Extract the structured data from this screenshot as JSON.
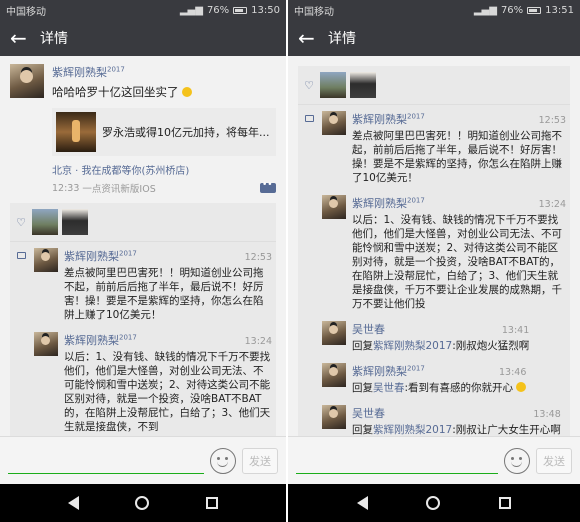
{
  "left": {
    "status": {
      "carrier": "中国移动",
      "battery": "76%",
      "time": "13:50"
    },
    "title": "详情",
    "post": {
      "author": "紫辉刚熟梨",
      "author_sup": "2017",
      "text": "哈哈哈罗十亿这回坐实了",
      "link_title": "罗永浩或得10亿元加持，将每年...",
      "location": "北京 · 我在成都等你(苏州桥店)",
      "time": "12:33",
      "source": "一点资讯新版IOS"
    },
    "comments": [
      {
        "name": "紫辉刚熟梨",
        "sup": "2017",
        "time": "12:53",
        "text": "差点被阿里巴巴害死！！明知道创业公司拖不起，前前后后拖了半年，最后说不！好厉害！操！要是不是紫辉的坚持，你怎么在陷阱上赚了10亿美元！"
      },
      {
        "name": "紫辉刚熟梨",
        "sup": "2017",
        "time": "13:24",
        "text": "以后：1、没有钱、缺钱的情况下千万不要找他们，他们是大怪兽，对创业公司无法、不可能怜悯和雪中送炭；2、对待这类公司不能区别对待，就是一个投资，没啥BAT不BAT的，在陷阱上没帮屁忙，白给了；3、他们天生就是接盘侠，不到"
      }
    ],
    "send_label": "发送"
  },
  "right": {
    "status": {
      "carrier": "中国移动",
      "battery": "76%",
      "time": "13:51"
    },
    "title": "详情",
    "comments": [
      {
        "name": "紫辉刚熟梨",
        "sup": "2017",
        "time": "12:53",
        "reply_to": "",
        "emoji": false,
        "text": "差点被阿里巴巴害死！！明知道创业公司拖不起，前前后后拖了半年，最后说不！好厉害！操！要是不是紫辉的坚持，你怎么在陷阱上赚了10亿美元！"
      },
      {
        "name": "紫辉刚熟梨",
        "sup": "2017",
        "time": "13:24",
        "reply_to": "",
        "emoji": false,
        "text": "以后：1、没有钱、缺钱的情况下千万不要找他们，他们是大怪兽，对创业公司无法、不可能怜悯和雪中送炭；2、对待这类公司不能区别对待，就是一个投资，没啥BAT不BAT的，在陷阱上没帮屁忙，白给了；3、他们天生就是接盘侠，千万不要让企业发展的成熟期，千万不要让他们投"
      },
      {
        "name": "吴世春",
        "sup": "",
        "time": "13:41",
        "reply_to": "紫辉刚熟梨2017",
        "emoji": false,
        "text": ":刚叔炮火猛烈啊"
      },
      {
        "name": "紫辉刚熟梨",
        "sup": "2017",
        "time": "13:46",
        "reply_to": "吴世春",
        "emoji": true,
        "text": ":看到有喜感的你就开心"
      },
      {
        "name": "吴世春",
        "sup": "",
        "time": "13:48",
        "reply_to": "紫辉刚熟梨2017",
        "emoji": false,
        "text": ":刚叔让广大女生开心啊"
      }
    ],
    "reply_word": "回复",
    "send_label": "发送"
  }
}
